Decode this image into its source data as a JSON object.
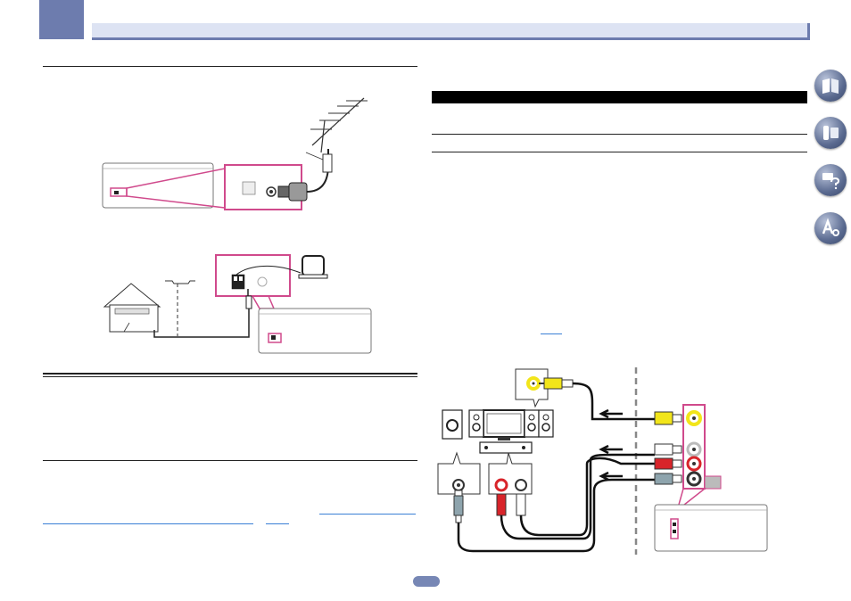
{
  "page": {
    "number": ""
  },
  "side_nav": {
    "items": [
      {
        "name": "manual",
        "icon": "book-icon"
      },
      {
        "name": "remote",
        "icon": "remote-icon"
      },
      {
        "name": "troubleshooting",
        "icon": "question-icon"
      },
      {
        "name": "glossary",
        "icon": "glossary-icon"
      }
    ]
  },
  "colors": {
    "accent": "#d04a8c",
    "chapter": "#6d7cae",
    "header_bg": "#dde3f3",
    "video_yellow": "#f2e51a",
    "audio_red": "#d8242a",
    "coax_gray": "#8ea4ad",
    "link": "#3a7fd5"
  },
  "figures": {
    "fm_antenna": {
      "icon": "fm-antenna-icon"
    },
    "am_antenna": {
      "icon": "am-loop-antenna-icon"
    },
    "connection": {
      "icon": "av-connection-diagram"
    }
  }
}
